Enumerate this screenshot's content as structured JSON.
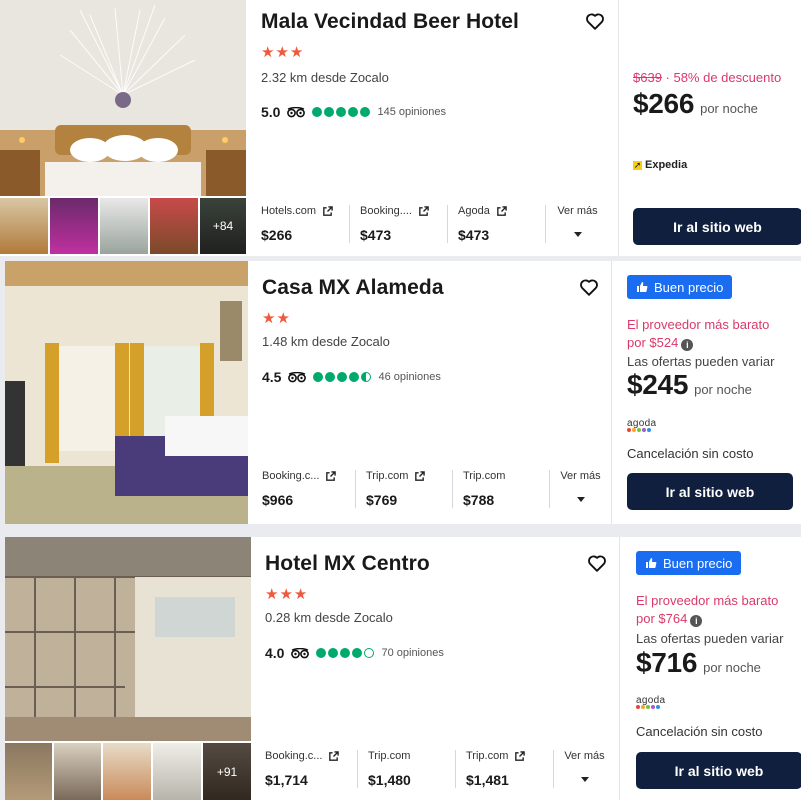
{
  "hotels": [
    {
      "name": "Mala Vecindad Beer Hotel",
      "stars": "★★★",
      "distance": "2.32 km desde Zocalo",
      "rating": "5.0",
      "bubbles": [
        1,
        1,
        1,
        1,
        1
      ],
      "reviews": "145 opiniones",
      "providers": [
        {
          "name": "Hotels.com",
          "price": "$266"
        },
        {
          "name": "Booking....",
          "price": "$473"
        },
        {
          "name": "Agoda",
          "price": "$473"
        }
      ],
      "more_label": "Ver más",
      "original_price": "$639",
      "discount": " · 58% de descuento",
      "price": "$266",
      "per_night": "por noche",
      "provider_logo": "Expedia",
      "cta": "Ir al sitio web",
      "thumbs_more": "+84",
      "photo_colors": [
        "#e7e3de",
        "#c9a36b",
        "#6b4a2f"
      ]
    },
    {
      "name": "Casa MX Alameda",
      "stars": "★★",
      "distance": "1.48 km desde Zocalo",
      "rating": "4.5",
      "bubbles": [
        1,
        1,
        1,
        1,
        0.5
      ],
      "reviews": "46 opiniones",
      "providers": [
        {
          "name": "Booking.c...",
          "price": "$966"
        },
        {
          "name": "Trip.com",
          "price": "$769"
        },
        {
          "name": "Trip.com",
          "price": "$788"
        }
      ],
      "more_label": "Ver más",
      "badge": "Buen precio",
      "cheapest_line1": "El proveedor más barato",
      "cheapest_line2": "por $524",
      "offers_vary": "Las ofertas pueden variar",
      "price": "$245",
      "per_night": "por noche",
      "provider_logo": "agoda",
      "cancellation": "Cancelación sin costo",
      "cta": "Ir al sitio web"
    },
    {
      "name": "Hotel MX Centro",
      "stars": "★★★",
      "distance": "0.28 km desde Zocalo",
      "rating": "4.0",
      "bubbles": [
        1,
        1,
        1,
        1,
        0
      ],
      "reviews": "70 opiniones",
      "providers": [
        {
          "name": "Booking.c...",
          "price": "$1,714"
        },
        {
          "name": "Trip.com",
          "price": "$1,480"
        },
        {
          "name": "Trip.com",
          "price": "$1,481"
        }
      ],
      "more_label": "Ver más",
      "badge": "Buen precio",
      "cheapest_line1": "El proveedor más barato",
      "cheapest_line2": "por $764",
      "offers_vary": "Las ofertas pueden variar",
      "price": "$716",
      "per_night": "por noche",
      "provider_logo": "agoda",
      "cancellation": "Cancelación sin costo",
      "cta": "Ir al sitio web",
      "thumbs_more": "+91"
    }
  ],
  "colors": {
    "accent_pink": "#d93a6b",
    "cta_navy": "#0f1f3d",
    "badge_blue": "#1a6cf0",
    "star_orange": "#ef5a3c",
    "tripadvisor_green": "#00aa6c"
  }
}
